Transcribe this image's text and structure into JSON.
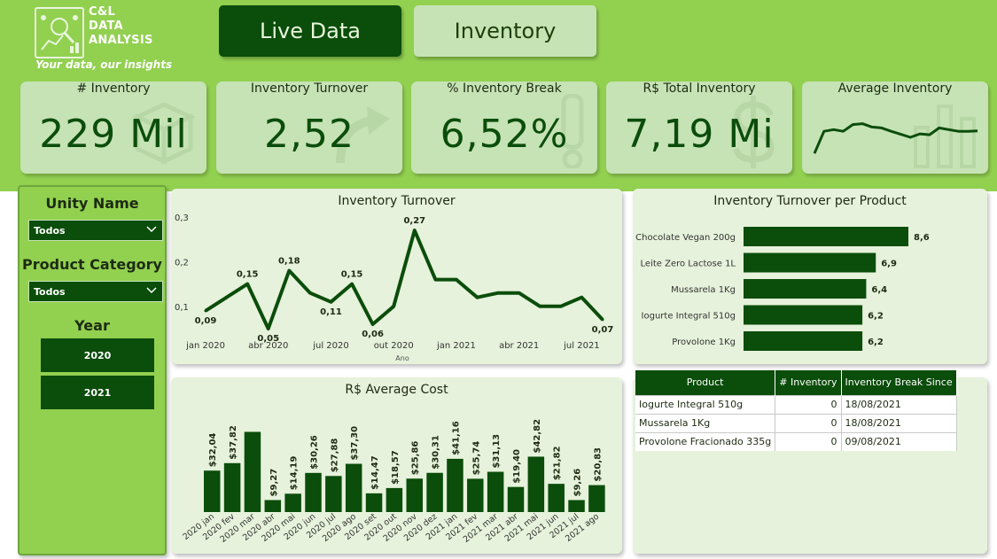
{
  "logo": {
    "title_line1": "C&L",
    "title_line2": "DATA",
    "title_line3": "ANALYSIS",
    "tagline": "Your data, our insights"
  },
  "tabs": [
    {
      "label": "Live Data"
    },
    {
      "label": "Inventory"
    }
  ],
  "kpis": [
    {
      "label": "# Inventory",
      "value": "229 Mil",
      "icon": "box-icon"
    },
    {
      "label": "Inventory Turnover",
      "value": "2,52",
      "icon": "curved-arrow-icon"
    },
    {
      "label": "% Inventory Break",
      "value": "6,52%",
      "icon": "exclamation-icon"
    },
    {
      "label": "R$ Total Inventory",
      "value": "7,19 Mi",
      "icon": "dollar-icon"
    },
    {
      "label": "Average Inventory",
      "value": "",
      "icon": "bar-chart-icon"
    }
  ],
  "filters": {
    "unity_name": {
      "title": "Unity Name",
      "selected": "Todos"
    },
    "product_category": {
      "title": "Product Category",
      "selected": "Todos"
    },
    "year": {
      "title": "Year",
      "options": [
        "2020",
        "2021"
      ]
    }
  },
  "table": {
    "headers": [
      "Product",
      "# Inventory",
      "Inventory Break Since"
    ],
    "rows": [
      [
        "Iogurte Integral 510g",
        "0",
        "18/08/2021"
      ],
      [
        "Mussarela 1Kg",
        "0",
        "18/08/2021"
      ],
      [
        "Provolone Fracionado 335g",
        "0",
        "09/08/2021"
      ]
    ]
  },
  "colors": {
    "dark_green": "#0b4d0b",
    "light_green": "#92d050",
    "card_green": "#c6e3b5",
    "panel_bg": "#e6f2db"
  },
  "chart_data": [
    {
      "type": "line",
      "title": "Inventory Turnover",
      "xlabel": "Ano",
      "ylabel": "",
      "ylim": [
        0.07,
        0.3
      ],
      "yticks": [
        "0,3",
        "0,2",
        "0,1"
      ],
      "xtick_labels": [
        "jan 2020",
        "abr 2020",
        "jul 2020",
        "out 2020",
        "jan 2021",
        "abr 2021",
        "jul 2021"
      ],
      "x": [
        "2020-01",
        "2020-02",
        "2020-03",
        "2020-04",
        "2020-05",
        "2020-06",
        "2020-07",
        "2020-08",
        "2020-09",
        "2020-10",
        "2020-11",
        "2020-12",
        "2021-01",
        "2021-02",
        "2021-03",
        "2021-04",
        "2021-05",
        "2021-06",
        "2021-07",
        "2021-08"
      ],
      "values": [
        0.09,
        0.12,
        0.15,
        0.05,
        0.18,
        0.13,
        0.11,
        0.15,
        0.06,
        0.1,
        0.27,
        0.16,
        0.16,
        0.12,
        0.13,
        0.13,
        0.1,
        0.1,
        0.12,
        0.07
      ],
      "data_labels": [
        {
          "index": 0,
          "text": "0,09"
        },
        {
          "index": 2,
          "text": "0,15"
        },
        {
          "index": 3,
          "text": "0,05"
        },
        {
          "index": 4,
          "text": "0,18"
        },
        {
          "index": 6,
          "text": "0,11"
        },
        {
          "index": 7,
          "text": "0,15"
        },
        {
          "index": 8,
          "text": "0,06"
        },
        {
          "index": 10,
          "text": "0,27"
        },
        {
          "index": 19,
          "text": "0,07"
        }
      ]
    },
    {
      "type": "bar",
      "orientation": "horizontal",
      "title": "Inventory Turnover per Product",
      "categories": [
        "Chocolate Vegan 200g",
        "Leite Zero Lactose 1L",
        "Mussarela 1Kg",
        "Iogurte Integral 510g",
        "Provolone 1Kg"
      ],
      "values": [
        8.6,
        6.9,
        6.4,
        6.2,
        6.2
      ],
      "labels": [
        "8,6",
        "6,9",
        "6,4",
        "6,2",
        "6,2"
      ]
    },
    {
      "type": "bar",
      "title": "R$ Average Cost",
      "categories": [
        "2020 jan",
        "2020 fev",
        "2020 mar",
        "2020 abr",
        "2020 mai",
        "2020 jun",
        "2020 jul",
        "2020 ago",
        "2020 set",
        "2020 out",
        "2020 nov",
        "2020 dez",
        "2021 jan",
        "2021 fev",
        "2021 mar",
        "2021 abr",
        "2021 mai",
        "2021 jun",
        "2021 jul",
        "2021 ago"
      ],
      "values": [
        32.04,
        37.82,
        62,
        9.27,
        14.19,
        30.26,
        27.88,
        37.3,
        14.47,
        18.57,
        25.86,
        30.31,
        41.16,
        25.74,
        31.13,
        19.4,
        42.82,
        21.82,
        9.26,
        20.83
      ],
      "labels": [
        "$32,04",
        "$37,82",
        "",
        "$9,27",
        "$14,19",
        "$30,26",
        "$27,88",
        "$37,30",
        "$14,47",
        "$18,57",
        "$25,86",
        "$30,31",
        "$41,16",
        "$25,74",
        "$31,13",
        "$19,40",
        "$42,82",
        "$21,82",
        "$9,26",
        "$20,83"
      ]
    },
    {
      "type": "line",
      "title": "",
      "values": [
        0.1,
        0.62,
        0.66,
        0.62,
        0.78,
        0.8,
        0.72,
        0.7,
        0.62,
        0.55,
        0.48,
        0.56,
        0.54,
        0.7,
        0.66,
        0.62,
        0.62,
        0.63
      ]
    }
  ]
}
